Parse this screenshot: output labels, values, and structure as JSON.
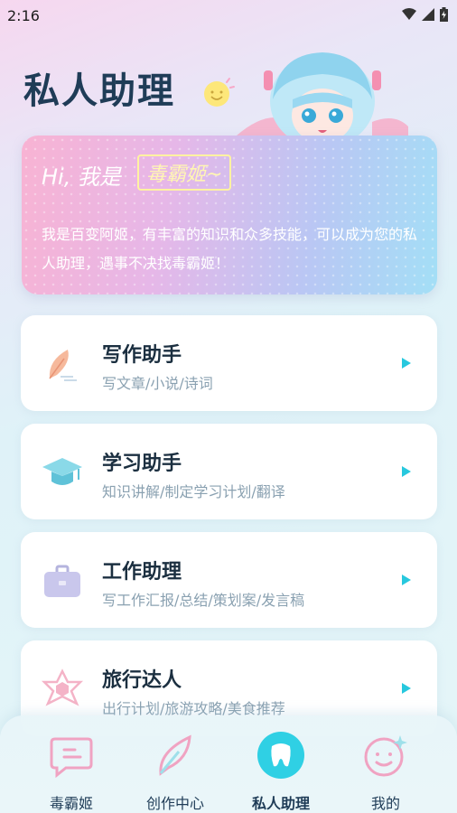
{
  "status": {
    "time": "2:16"
  },
  "page": {
    "title": "私人助理"
  },
  "hero": {
    "greeting": "Hi, 我是",
    "name": "毒霸姬~",
    "description": "我是百变阿姬，有丰富的知识和众多技能，可以成为您的私人助理，遇事不决找毒霸姬！"
  },
  "menu": [
    {
      "title": "写作助手",
      "subtitle": "写文章/小说/诗词",
      "icon": "feather-icon"
    },
    {
      "title": "学习助手",
      "subtitle": "知识讲解/制定学习计划/翻译",
      "icon": "graduation-cap-icon"
    },
    {
      "title": "工作助理",
      "subtitle": "写工作汇报/总结/策划案/发言稿",
      "icon": "briefcase-icon"
    },
    {
      "title": "旅行达人",
      "subtitle": "出行计划/旅游攻略/美食推荐",
      "icon": "travel-star-icon"
    }
  ],
  "nav": [
    {
      "label": "毒霸姬",
      "icon": "chat-icon"
    },
    {
      "label": "创作中心",
      "icon": "quill-icon"
    },
    {
      "label": "私人助理",
      "icon": "tooth-icon",
      "active": true
    },
    {
      "label": "我的",
      "icon": "smile-sparkle-icon"
    }
  ],
  "colors": {
    "accent": "#27c8de",
    "title": "#1f3c57"
  }
}
